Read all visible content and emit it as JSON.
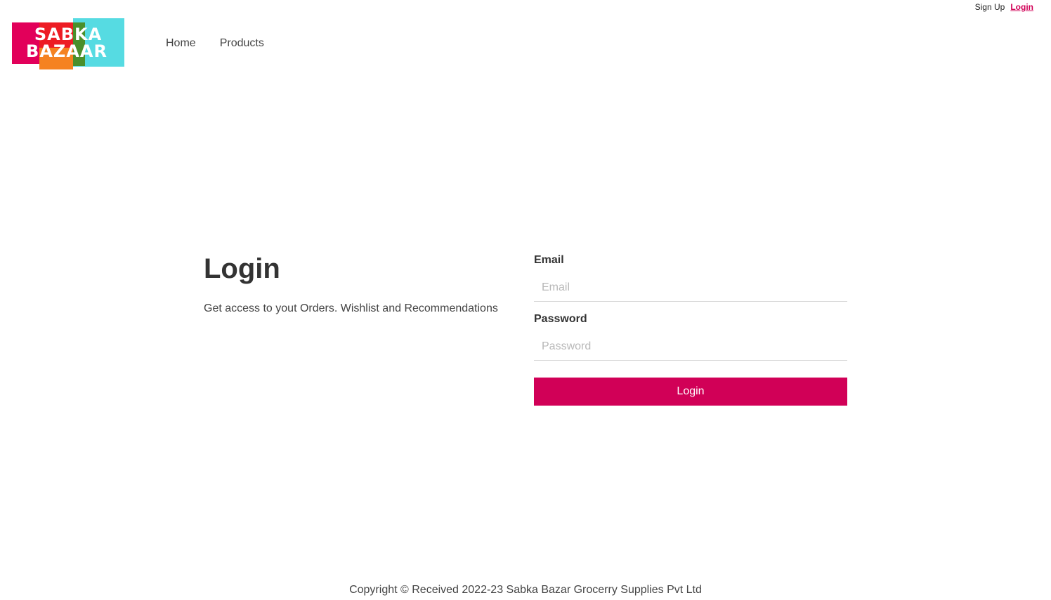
{
  "header": {
    "logo_text_line1": "SABKA",
    "logo_text_line2": "BAZAAR",
    "account_links": {
      "signup_label": "Sign Up",
      "login_label": "Login"
    },
    "nav": {
      "home_label": "Home",
      "products_label": "Products"
    }
  },
  "login": {
    "title": "Login",
    "subtitle": "Get access to yout Orders. Wishlist and Recommendations",
    "email_label": "Email",
    "email_placeholder": "Email",
    "password_label": "Password",
    "password_placeholder": "Password",
    "submit_label": "Login"
  },
  "footer": {
    "copyright": "Copyright © Received 2022-23 Sabka Bazar Grocerry Supplies Pvt Ltd"
  },
  "colors": {
    "accent": "#d10057",
    "logo_cyan": "#56dbe2",
    "logo_pink": "#e2005a",
    "logo_red": "#ed1c24",
    "logo_orange": "#f58220",
    "logo_green": "#4a8f2b"
  }
}
